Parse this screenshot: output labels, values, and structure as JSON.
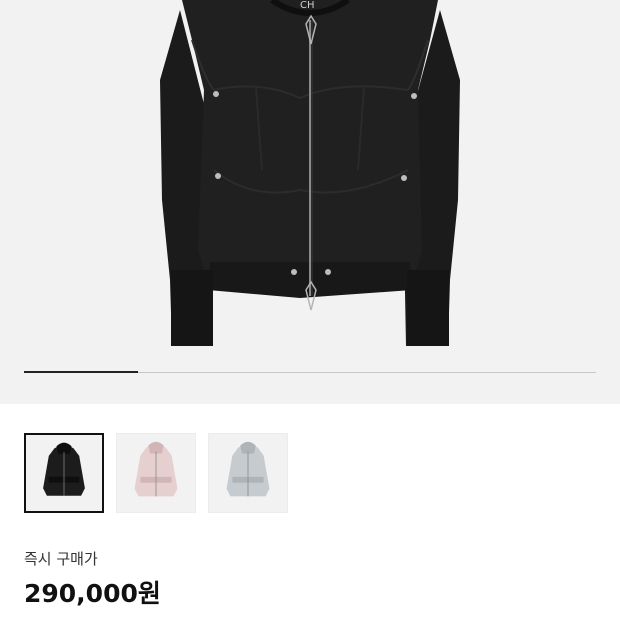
{
  "hero": {
    "brand_mark": "CH",
    "carousel_progress": 0.2
  },
  "thumbnails": [
    {
      "label": "black",
      "color": "#1c1c1c",
      "shade": "#0e0e0e",
      "selected": true
    },
    {
      "label": "pink",
      "color": "#e6cfcf",
      "shade": "#d2b6b6",
      "selected": false
    },
    {
      "label": "grey",
      "color": "#c6cbcf",
      "shade": "#aeb4b8",
      "selected": false
    }
  ],
  "price": {
    "label": "즉시 구매가",
    "value": "290,000원"
  }
}
